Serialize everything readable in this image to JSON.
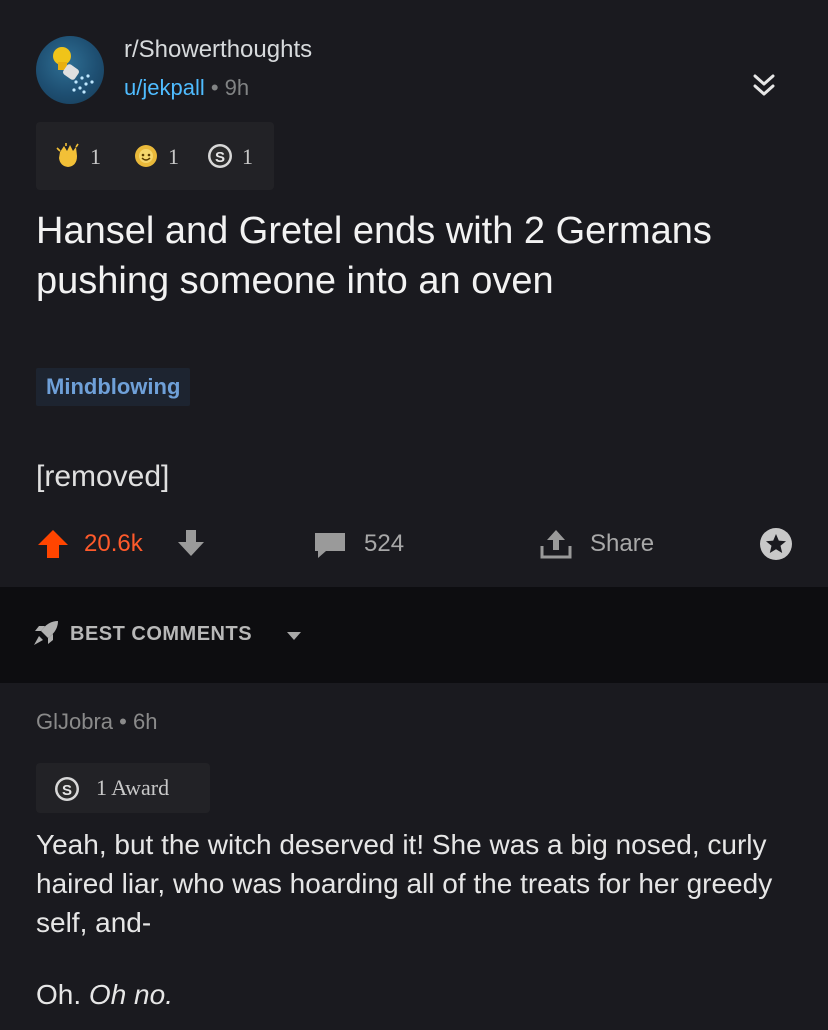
{
  "post": {
    "subreddit": "r/Showerthoughts",
    "author": "u/jekpall",
    "separator": "•",
    "age": "9h",
    "awards": [
      {
        "icon": "clapping-hands-award-icon",
        "count": "1"
      },
      {
        "icon": "wholesome-award-icon",
        "count": "1"
      },
      {
        "icon": "silver-award-icon",
        "count": "1"
      }
    ],
    "title": "Hansel and Gretel ends with 2 Germans pushing someone into an oven",
    "flair": "Mindblowing",
    "body": "[removed]",
    "score": "20.6k",
    "comment_count": "524",
    "share_label": "Share"
  },
  "sort": {
    "label": "BEST COMMENTS"
  },
  "comment": {
    "author": "GlJobra",
    "separator": "•",
    "age": "6h",
    "award_label": "1 Award",
    "body": "Yeah, but the witch deserved it! She was a big nosed, curly haired liar, who was hoarding all of the treats for her greedy self, and-",
    "reply_plain": "Oh.",
    "reply_italic": "Oh no."
  },
  "colors": {
    "background": "#1a1a1f",
    "upvote": "#ff4500",
    "link": "#4fbcff",
    "flair_text": "#6fa0d8"
  }
}
